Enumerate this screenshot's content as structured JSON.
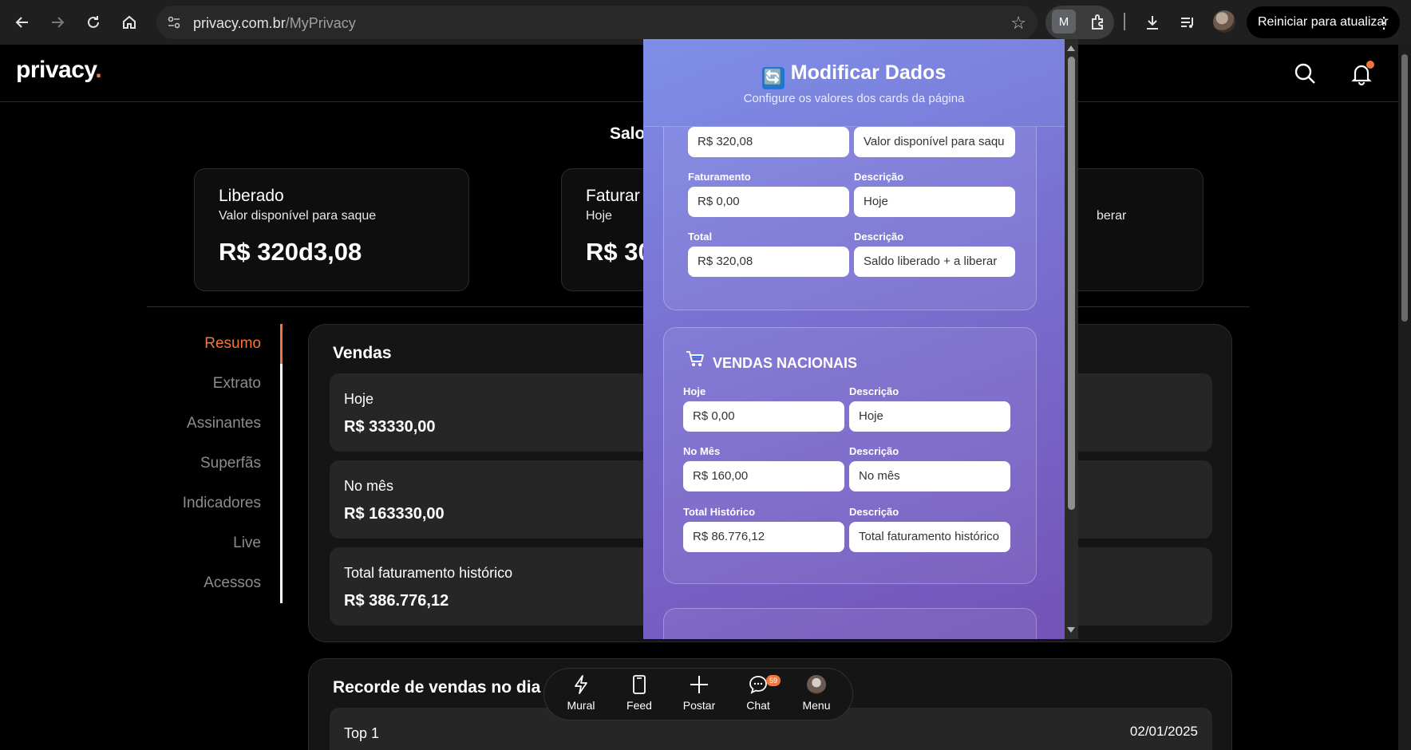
{
  "browser": {
    "url_host": "privacy.com.br",
    "url_path": "/MyPrivacy",
    "extension_letter": "M",
    "update_button": "Reiniciar para atualizar"
  },
  "site": {
    "logo": "privacy",
    "logo_dot": "."
  },
  "saldo": {
    "title": "Salo",
    "cards": [
      {
        "title": "Liberado",
        "subtitle": "Valor disponível para saque",
        "value": "R$ 320d3,08"
      },
      {
        "title": "Faturar",
        "subtitle": "Hoje",
        "value": "R$ 30"
      },
      {
        "title": "",
        "subtitle": "berar",
        "value": ""
      }
    ]
  },
  "side_nav": {
    "items": [
      "Resumo",
      "Extrato",
      "Assinantes",
      "Superfãs",
      "Indicadores",
      "Live",
      "Acessos"
    ],
    "active": "Resumo"
  },
  "vendas": {
    "title": "Vendas",
    "rows": [
      {
        "label": "Hoje",
        "value": "R$ 33330,00"
      },
      {
        "label": "No mês",
        "value": "R$ 163330,00"
      },
      {
        "label": "Total faturamento histórico",
        "value": "R$ 386.776,12"
      }
    ]
  },
  "recorde": {
    "title": "Recorde de vendas no dia",
    "rows": [
      {
        "label": "Top 1",
        "date": "02/01/2025"
      }
    ]
  },
  "bottom_nav": {
    "items": [
      {
        "label": "Mural",
        "icon": "bolt-icon"
      },
      {
        "label": "Feed",
        "icon": "phone-icon"
      },
      {
        "label": "Postar",
        "icon": "plus-icon"
      },
      {
        "label": "Chat",
        "icon": "chat-icon"
      },
      {
        "label": "Menu",
        "icon": "avatar-icon"
      }
    ],
    "chat_badge": "59"
  },
  "popup": {
    "title": "Modificar Dados",
    "title_icon": "🔄",
    "subtitle": "Configure os valores dos cards da página",
    "section1": {
      "fields": [
        {
          "label": "",
          "value": "R$ 320,08",
          "desc_label": "",
          "desc_value": "Valor disponível para saqu"
        },
        {
          "label": "Faturamento",
          "value": "R$ 0,00",
          "desc_label": "Descrição",
          "desc_value": "Hoje"
        },
        {
          "label": "Total",
          "value": "R$ 320,08",
          "desc_label": "Descrição",
          "desc_value": "Saldo liberado + a liberar"
        }
      ]
    },
    "section2": {
      "title": "VENDAS NACIONAIS",
      "fields": [
        {
          "label": "Hoje",
          "value": "R$ 0,00",
          "desc_label": "Descrição",
          "desc_value": "Hoje"
        },
        {
          "label": "No Mês",
          "value": "R$ 160,00",
          "desc_label": "Descrição",
          "desc_value": "No mês"
        },
        {
          "label": "Total Histórico",
          "value": "R$ 86.776,12",
          "desc_label": "Descrição",
          "desc_value": "Total faturamento histórico"
        }
      ]
    }
  },
  "colors": {
    "accent": "#f2763b",
    "popup_gradient_start": "#7d8ce6",
    "popup_gradient_end": "#7353b8"
  }
}
